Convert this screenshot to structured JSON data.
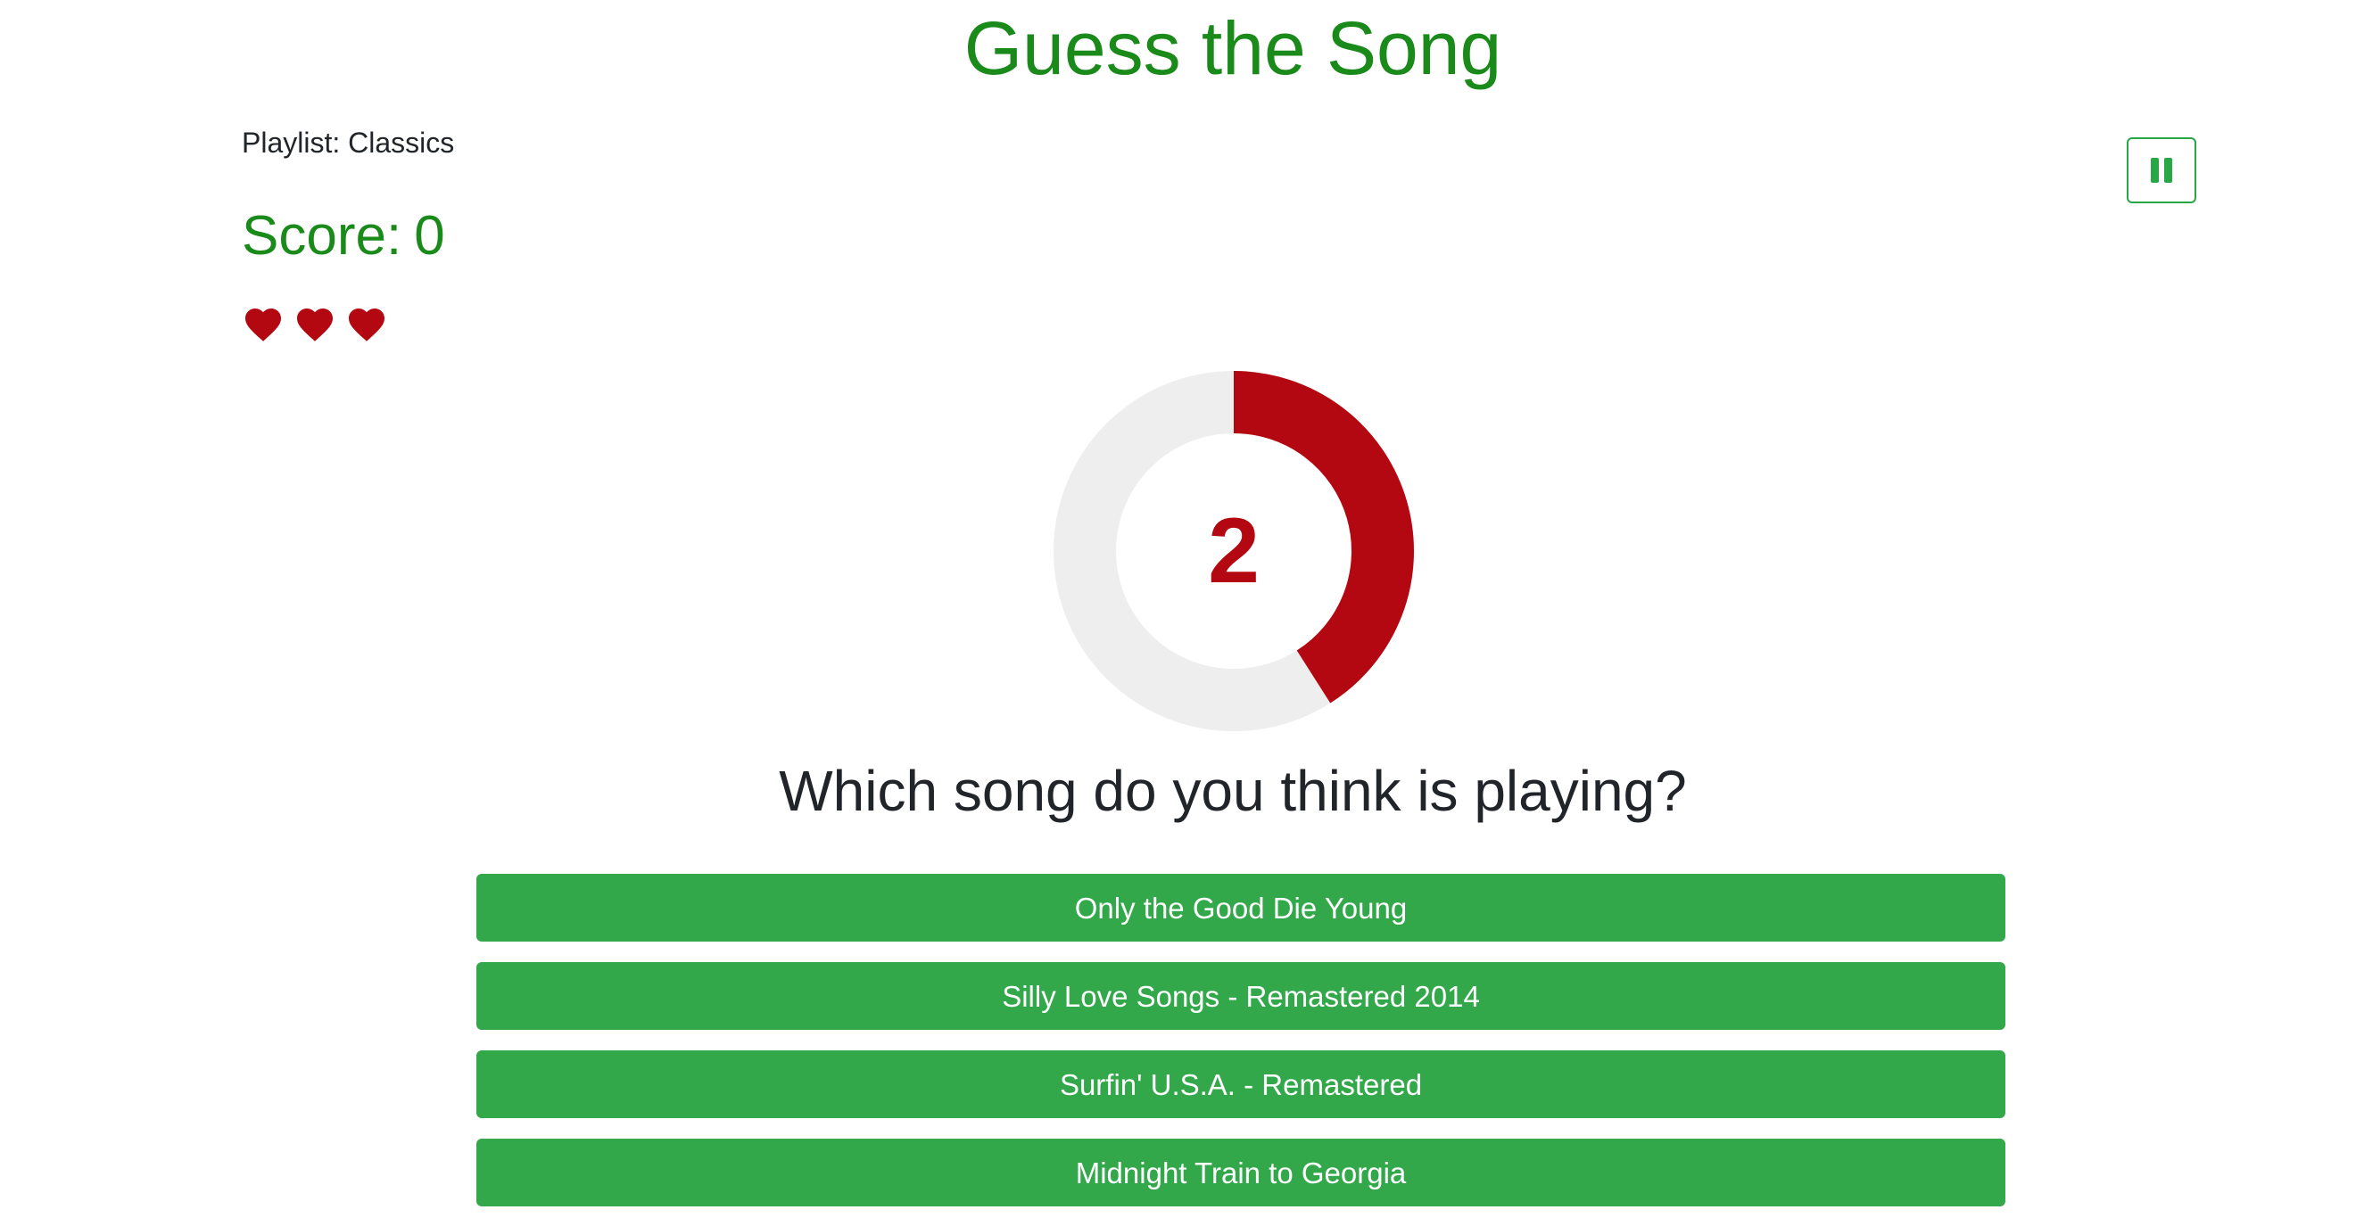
{
  "header": {
    "title": "Guess the Song"
  },
  "game": {
    "playlist_label": "Playlist: Classics",
    "score_label": "Score:",
    "score_value": "0",
    "lives": 3,
    "pause_icon": "pause-icon",
    "heart_icon": "heart-icon"
  },
  "timer": {
    "value": "2",
    "elapsed_fraction": 0.41,
    "ring_color": "#b30812",
    "track_color": "#eeeeee"
  },
  "question": {
    "text": "Which song do you think is playing?"
  },
  "answers": [
    {
      "label": "Only the Good Die Young"
    },
    {
      "label": "Silly Love Songs - Remastered 2014"
    },
    {
      "label": "Surfin' U.S.A. - Remastered"
    },
    {
      "label": "Midnight Train to Georgia"
    }
  ],
  "colors": {
    "title_green": "#1a8a1a",
    "button_green": "#33a84b",
    "heart_red": "#b30812"
  }
}
